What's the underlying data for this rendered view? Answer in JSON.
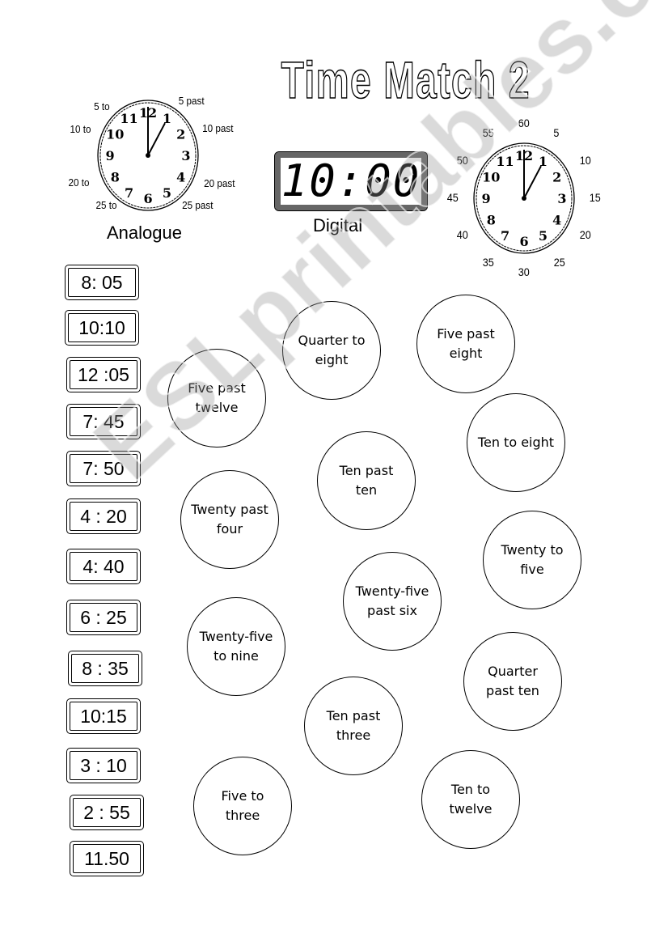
{
  "title": "Time Match 2",
  "analogue": {
    "caption": "Analogue",
    "labels": [
      "5 to",
      "5 past",
      "10 to",
      "10 past",
      "20 to",
      "20 past",
      "25 to",
      "25 past"
    ],
    "hour": 1,
    "minute": 0
  },
  "digital": {
    "caption": "Digital",
    "display": "10:00"
  },
  "minute_clock": {
    "labels": [
      "60",
      "5",
      "10",
      "15",
      "20",
      "25",
      "30",
      "35",
      "40",
      "45",
      "50",
      "55"
    ]
  },
  "clock_numerals": [
    "12",
    "1",
    "2",
    "3",
    "4",
    "5",
    "6",
    "7",
    "8",
    "9",
    "10",
    "11"
  ],
  "times": [
    "8: 05",
    "10:10",
    "12 :05",
    "7: 45",
    "7: 50",
    "4 : 20",
    "4: 40",
    "6 : 25",
    "8 : 35",
    "10:15",
    "3 : 10",
    "2 : 55",
    "11.50"
  ],
  "phrases": [
    "Five past twelve",
    "Quarter to eight",
    "Five past eight",
    "Ten to eight",
    "Ten past ten",
    "Twenty past four",
    "Twenty to five",
    "Twenty-five past six",
    "Twenty-five to nine",
    "Quarter past ten",
    "Ten past three",
    "Five to three",
    "Ten to twelve"
  ],
  "watermark": "ESLprintables.com"
}
